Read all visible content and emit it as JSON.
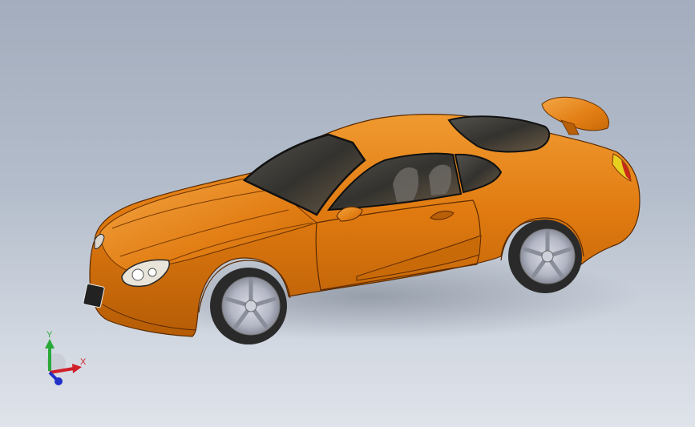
{
  "viewport": {
    "background_top": "#a3adbd",
    "background_bottom": "#dfe3ea"
  },
  "model": {
    "body_color": "#e07a10",
    "body_highlight": "#f5a040",
    "body_shadow": "#a04c05",
    "glass_color": "#3a3a36",
    "tail_light_color": "#e8d020",
    "wheel_color": "#b9bcc8",
    "tire_color": "#2a2a2a"
  },
  "triad": {
    "x_label": "X",
    "y_label": "Y",
    "x_color": "#d0202a",
    "y_color": "#2aa83a",
    "z_color": "#2030c8"
  }
}
